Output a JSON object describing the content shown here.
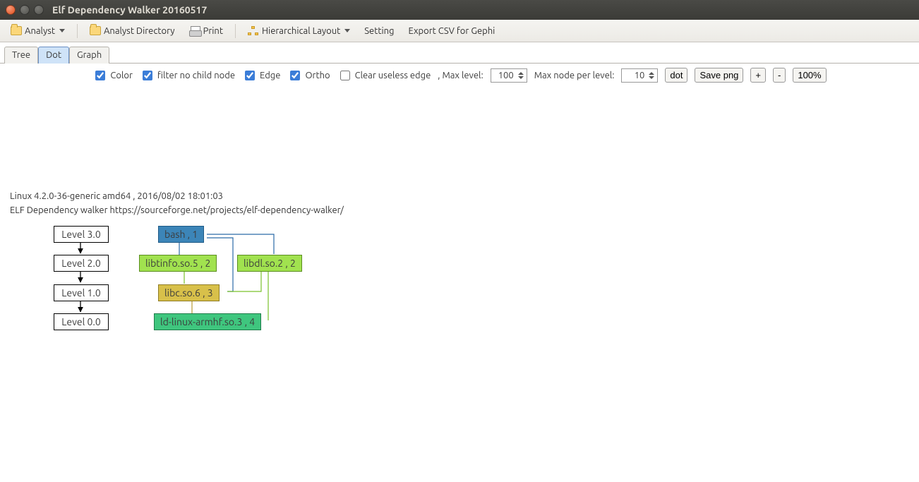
{
  "window": {
    "title": "Elf Dependency Walker 20160517"
  },
  "toolbar": {
    "analyst": "Analyst",
    "analyst_dir": "Analyst Directory",
    "print": "Print",
    "layout": "Hierarchical Layout",
    "setting": "Setting",
    "export": "Export CSV for Gephi"
  },
  "tabs": {
    "tree": "Tree",
    "dot": "Dot",
    "graph": "Graph"
  },
  "opts": {
    "color": "Color",
    "filter": "filter no child node",
    "edge": "Edge",
    "ortho": "Ortho",
    "clear": "Clear useless edge",
    "maxlevel_lbl": ", Max level:",
    "maxlevel_val": "100",
    "maxnode_lbl": "Max node per level:",
    "maxnode_val": "10",
    "dot_btn": "dot",
    "save_btn": "Save png",
    "zoom_in": "+",
    "zoom_out": "-",
    "zoom_pct": "100%"
  },
  "info": {
    "line1": "Linux 4.2.0-36-generic amd64 , 2016/08/02 18:01:03",
    "line2": "ELF Dependency walker https://sourceforge.net/projects/elf-dependency-walker/"
  },
  "levels": {
    "l3": "Level 3.0",
    "l2": "Level 2.0",
    "l1": "Level 1.0",
    "l0": "Level 0.0"
  },
  "nodes": {
    "bash": "bash , 1",
    "libtinfo": "libtinfo.so.5 , 2",
    "libdl": "libdl.so.2 , 2",
    "libc": "libc.so.6 , 3",
    "ldlinux": "ld-linux-armhf.so.3 , 4"
  }
}
